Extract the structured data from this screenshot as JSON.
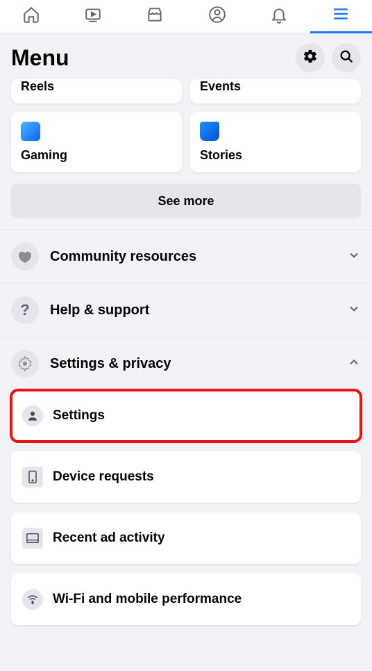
{
  "header": {
    "title": "Menu"
  },
  "shortcuts": {
    "reels": "Reels",
    "events": "Events",
    "gaming": "Gaming",
    "stories": "Stories",
    "see_more": "See more"
  },
  "sections": {
    "community": "Community resources",
    "help": "Help & support",
    "settings_privacy": "Settings & privacy"
  },
  "settings_items": {
    "settings": "Settings",
    "device_requests": "Device requests",
    "recent_ad": "Recent ad activity",
    "wifi": "Wi-Fi and mobile performance"
  },
  "colors": {
    "accent": "#1877f2"
  }
}
